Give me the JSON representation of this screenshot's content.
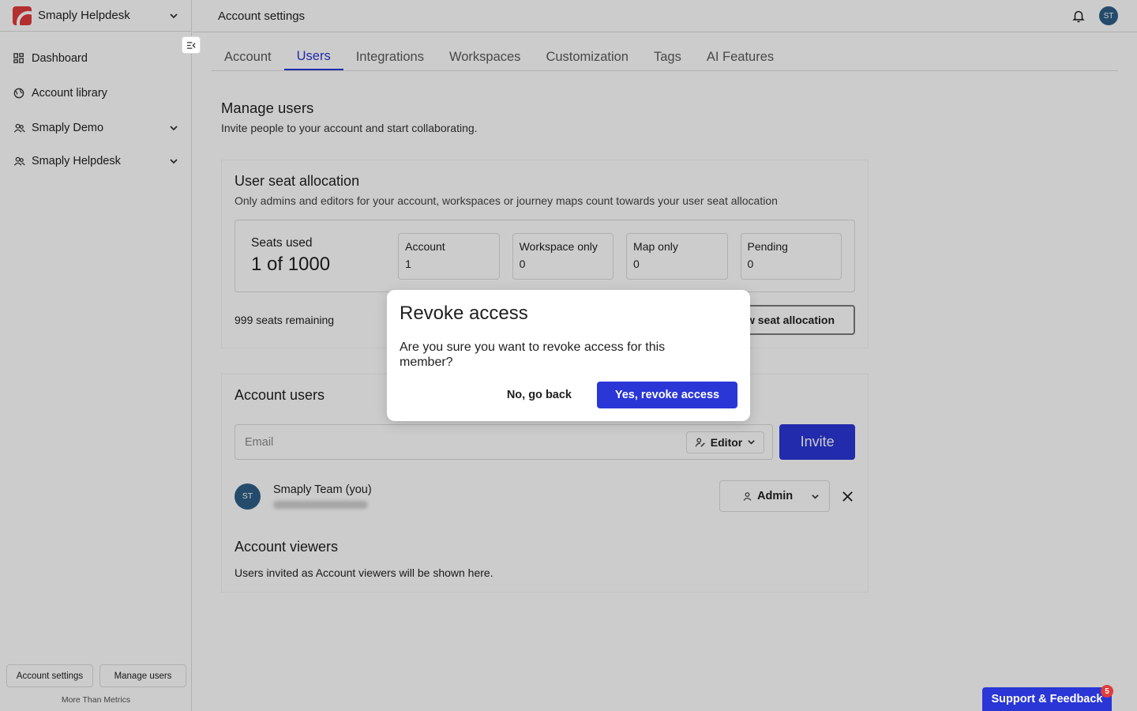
{
  "sidebar": {
    "brand": "Smaply Helpdesk",
    "items": [
      {
        "label": "Dashboard",
        "icon": "dashboard-icon"
      },
      {
        "label": "Account library",
        "icon": "globe-icon"
      }
    ],
    "groups": [
      {
        "label": "Smaply Demo",
        "icon": "users-icon"
      },
      {
        "label": "Smaply Helpdesk",
        "icon": "users-icon"
      }
    ],
    "bottom_buttons": {
      "account_settings": "Account settings",
      "manage_users": "Manage users"
    },
    "footer": "More Than Metrics"
  },
  "header": {
    "title": "Account settings",
    "avatar_initials": "ST"
  },
  "tabs": [
    {
      "label": "Account",
      "active": false
    },
    {
      "label": "Users",
      "active": true
    },
    {
      "label": "Integrations",
      "active": false
    },
    {
      "label": "Workspaces",
      "active": false
    },
    {
      "label": "Customization",
      "active": false
    },
    {
      "label": "Tags",
      "active": false
    },
    {
      "label": "AI Features",
      "active": false
    }
  ],
  "main": {
    "title": "Manage users",
    "subtitle": "Invite people to your account and start collaborating.",
    "seat_allocation": {
      "title": "User seat allocation",
      "description": "Only admins and editors for your account, workspaces or journey maps count towards your user seat allocation",
      "seats_used_label": "Seats used",
      "seats_used_value": "1 of 1000",
      "stats": [
        {
          "label": "Account",
          "value": "1"
        },
        {
          "label": "Workspace only",
          "value": "0"
        },
        {
          "label": "Map only",
          "value": "0"
        },
        {
          "label": "Pending",
          "value": "0"
        }
      ],
      "remaining": "999 seats remaining",
      "view_button": "View seat allocation"
    },
    "account_users": {
      "title": "Account users",
      "email_placeholder": "Email",
      "role_selected": "Editor",
      "invite_button": "Invite",
      "users": [
        {
          "initials": "ST",
          "name": "Smaply Team",
          "suffix": "(you)",
          "role": "Admin"
        }
      ]
    },
    "account_viewers": {
      "title": "Account viewers",
      "empty_text": "Users invited as Account viewers will be shown here."
    }
  },
  "modal": {
    "title": "Revoke access",
    "message": "Are you sure you want to revoke access for this member?",
    "cancel": "No, go back",
    "confirm": "Yes, revoke access"
  },
  "support": {
    "label": "Support & Feedback",
    "badge": "5"
  },
  "colors": {
    "accent": "#2a36d6",
    "brand": "#e23b3b",
    "avatar": "#2e5e87"
  }
}
